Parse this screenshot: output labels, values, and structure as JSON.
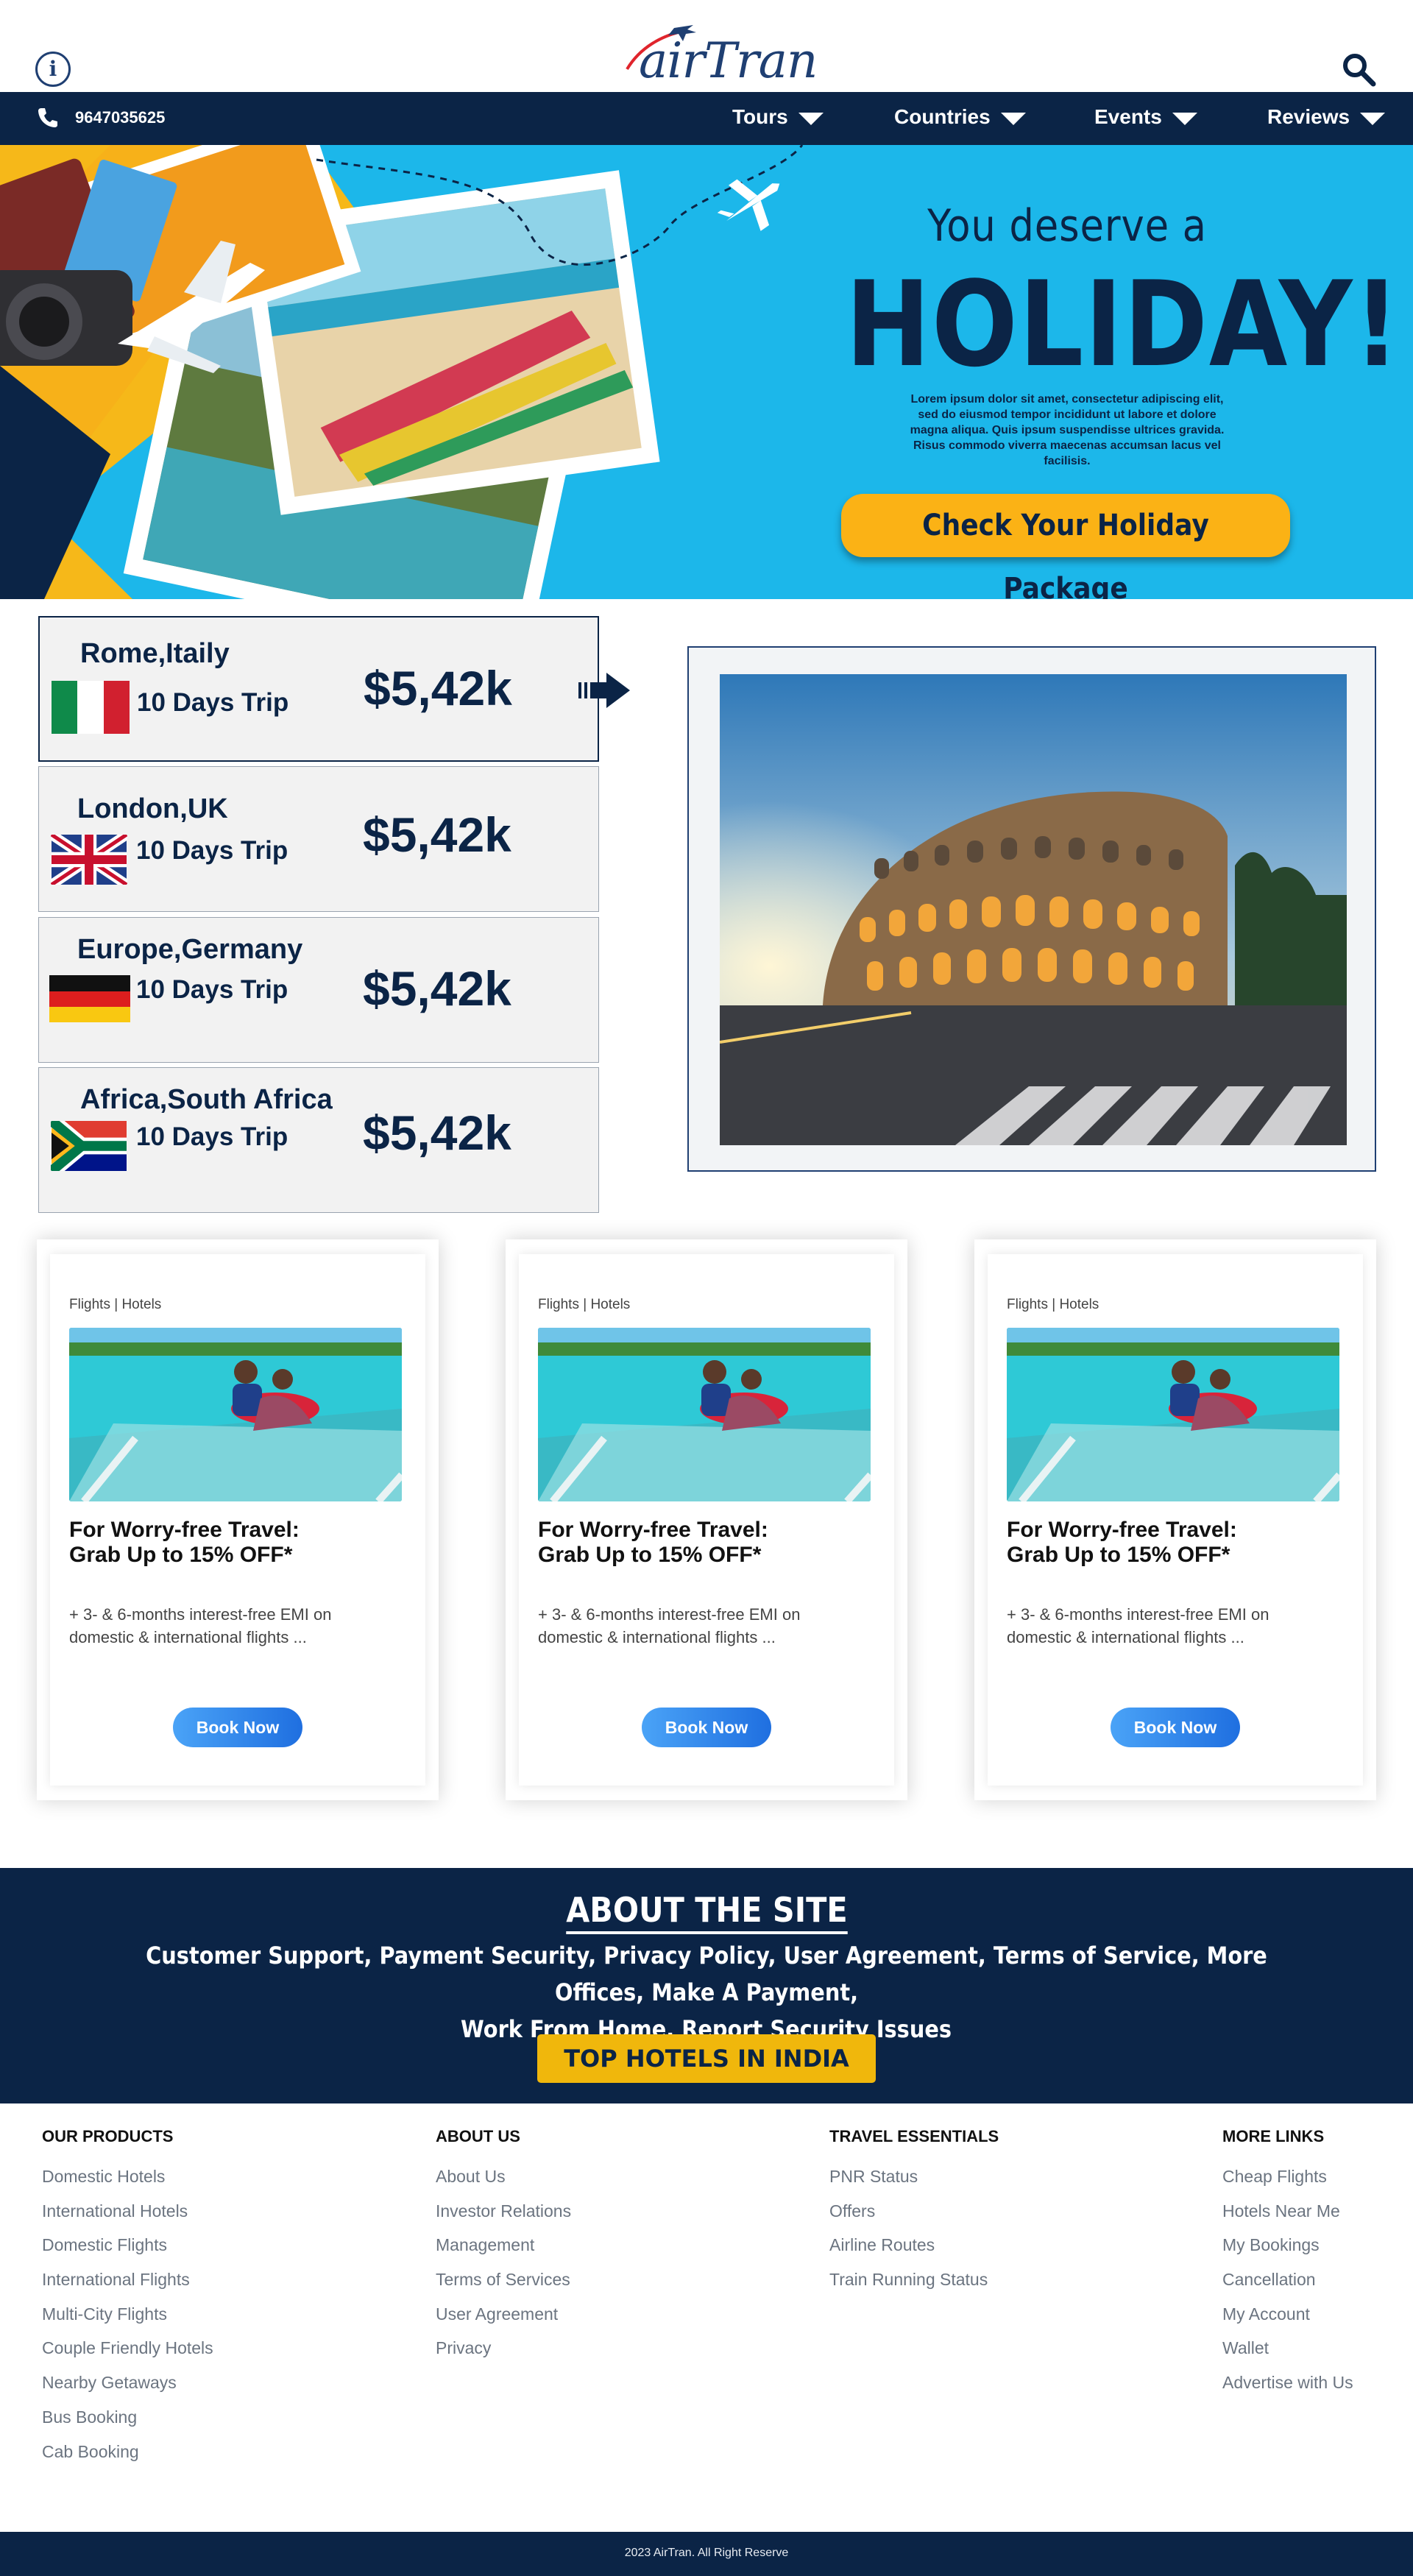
{
  "header": {
    "logo_text_a": "air",
    "logo_text_b": "Tran",
    "phone": "9647035625",
    "nav": [
      {
        "label": "Tours"
      },
      {
        "label": "Countries"
      },
      {
        "label": "Events"
      },
      {
        "label": "Reviews"
      }
    ]
  },
  "hero": {
    "subtitle": "You deserve a",
    "title": "HOLIDAY!",
    "description": "Lorem ipsum dolor sit amet, consectetur adipiscing elit, sed do eiusmod tempor incididunt ut labore et dolore magna aliqua. Quis ipsum suspendisse ultrices gravida. Risus commodo viverra maecenas accumsan lacus vel facilisis.",
    "cta": "Check Your Holiday Package"
  },
  "destinations": [
    {
      "city": "Rome,Itaily",
      "trip": "10 Days Trip",
      "price": "$5,42k",
      "flag": "italy-flag"
    },
    {
      "city": "London,UK",
      "trip": "10 Days Trip",
      "price": "$5,42k",
      "flag": "uk-flag"
    },
    {
      "city": "Europe,Germany",
      "trip": "10 Days Trip",
      "price": "$5,42k",
      "flag": "germany-flag"
    },
    {
      "city": "Africa,South Africa",
      "trip": "10 Days Trip",
      "price": "$5,42k",
      "flag": "south-africa-flag"
    }
  ],
  "offers": [
    {
      "tag": "Flights | Hotels",
      "title": "For Worry-free Travel: Grab Up to 15% OFF*",
      "desc": "+ 3- & 6-months interest-free EMI on domestic & international flights ...",
      "button": "Book Now"
    },
    {
      "tag": "Flights | Hotels",
      "title": "For Worry-free Travel: Grab Up to 15% OFF*",
      "desc": "+ 3- & 6-months interest-free EMI on domestic & international flights ...",
      "button": "Book Now"
    },
    {
      "tag": "Flights | Hotels",
      "title": "For Worry-free Travel: Grab Up to 15% OFF*",
      "desc": "+ 3- & 6-months interest-free EMI on domestic & international flights ...",
      "button": "Book Now"
    }
  ],
  "about": {
    "title": "ABOUT THE SITE",
    "links_line1": "Customer Support, Payment Security, Privacy Policy, User Agreement, Terms of Service, More Offices, Make A Payment,",
    "links_line2": "Work From Home, Report Security Issues",
    "button": "TOP HOTELS IN INDIA"
  },
  "footer": {
    "columns": [
      {
        "heading": "OUR PRODUCTS",
        "items": [
          "Domestic Hotels",
          "International Hotels",
          "Domestic Flights",
          "International Flights",
          "Multi-City Flights",
          "Couple Friendly Hotels",
          "Nearby Getaways",
          "Bus Booking",
          "Cab Booking"
        ]
      },
      {
        "heading": "ABOUT US",
        "items": [
          "About Us",
          "Investor Relations",
          "Management",
          "Terms of Services",
          "User Agreement",
          "Privacy"
        ]
      },
      {
        "heading": "TRAVEL ESSENTIALS",
        "items": [
          "PNR Status",
          "Offers",
          "Airline Routes",
          "Train Running Status"
        ]
      },
      {
        "heading": "MORE LINKS",
        "items": [
          "Cheap Flights",
          "Hotels Near Me",
          "My Bookings",
          "Cancellation",
          "My Account",
          "Wallet",
          "Advertise with Us"
        ]
      }
    ],
    "copyright": "2023 AirTran. All Right Reserve"
  },
  "colors": {
    "navy": "#0b2446",
    "hero_blue": "#1cb7ea",
    "cta_yellow": "#fbb215",
    "about_button": "#f0b70c"
  }
}
